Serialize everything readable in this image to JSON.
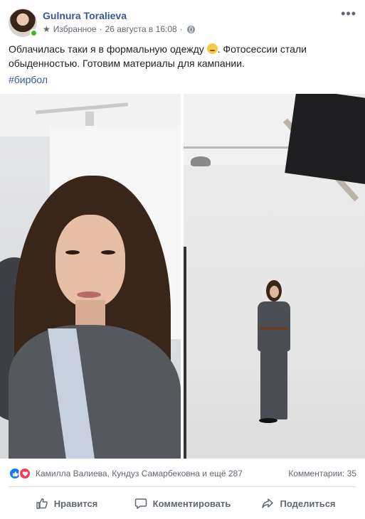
{
  "post": {
    "author": "Gulnura Toralieva",
    "audience": "Избранное",
    "separator": "·",
    "timestamp": "26 августа в 16:08",
    "text_before_emoji": "Облачилась таки я в формальную одежду ",
    "text_after_emoji": ". Фотосессии стали обыденностью. Готовим материалы для кампании.",
    "emoji_name": "pensive-face",
    "hashtag": "#бирбол",
    "more_glyph": "•••"
  },
  "stats": {
    "likers": "Камилла Валиева, Кундуз Самарбековна и ещё 287",
    "comments": "Комментарии: 35",
    "reaction_types": [
      "like",
      "love"
    ]
  },
  "actions": {
    "like_label": "Нравится",
    "comment_label": "Комментировать",
    "share_label": "Поделиться"
  },
  "colors": {
    "link": "#365899",
    "secondary_text": "#606770",
    "like_blue": "#1877f2",
    "love_red": "#f33e58",
    "online_green": "#42b72a"
  },
  "icons": {
    "audience": "star-icon",
    "privacy": "globe-icon",
    "like": "thumbs-up-icon",
    "comment": "speech-bubble-icon",
    "share": "share-arrow-icon"
  }
}
